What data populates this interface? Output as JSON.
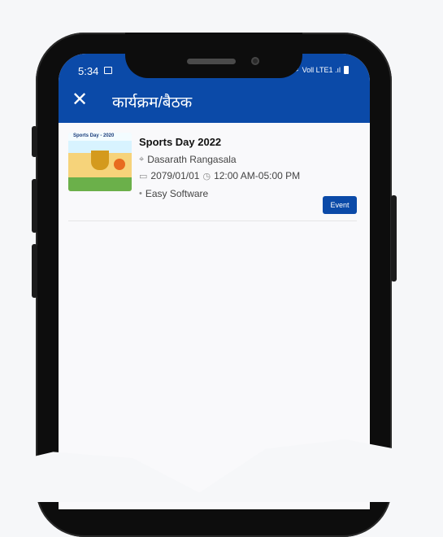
{
  "status_bar": {
    "time": "5:34",
    "signal_text": "Voll LTE1 .ıl"
  },
  "app_bar": {
    "title": "कार्यक्रम/बैठक"
  },
  "list": {
    "items": [
      {
        "thumbnail_title": "Sports Day - 2020",
        "title": "Sports Day 2022",
        "location": "Dasarath Rangasala",
        "date": "2079/01/01",
        "time": "12:00 AM-05:00 PM",
        "organizer": "Easy Software",
        "badge": "Event"
      }
    ]
  },
  "colors": {
    "primary": "#0b4aa8",
    "background": "#f9f9fb"
  }
}
